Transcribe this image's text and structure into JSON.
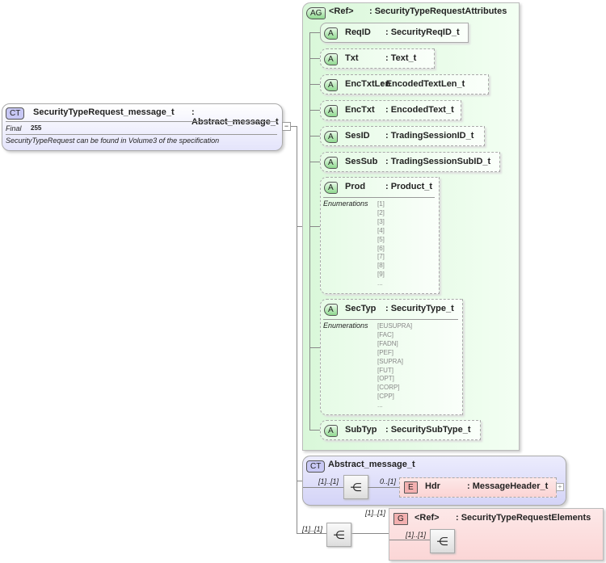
{
  "main_type": {
    "badge": "CT",
    "name": "SecurityTypeRequest_message_t",
    "base": ": Abstract_message_t",
    "final_label": "Final",
    "final_value": "255",
    "doc": "SecurityTypeRequest can be found in Volume3 of the specification"
  },
  "attribute_group": {
    "badge": "AG",
    "name": "<Ref>",
    "type": ": SecurityTypeRequestAttributes"
  },
  "attributes": [
    {
      "badge": "A",
      "name": "ReqID",
      "type": ": SecurityReqID_t"
    },
    {
      "badge": "A",
      "name": "Txt",
      "type": ": Text_t"
    },
    {
      "badge": "A",
      "name": "EncTxtLen",
      "type": ": EncodedTextLen_t"
    },
    {
      "badge": "A",
      "name": "EncTxt",
      "type": ": EncodedText_t"
    },
    {
      "badge": "A",
      "name": "SesID",
      "type": ": TradingSessionID_t"
    },
    {
      "badge": "A",
      "name": "SesSub",
      "type": ": TradingSessionSubID_t"
    },
    {
      "badge": "A",
      "name": "Prod",
      "type": ": Product_t",
      "enum_label": "Enumerations",
      "enums": "[1]\n[2]\n[3]\n[4]\n[5]\n[6]\n[7]\n[8]\n[9]\n..."
    },
    {
      "badge": "A",
      "name": "SecTyp",
      "type": ": SecurityType_t",
      "enum_label": "Enumerations",
      "enums": "[EUSUPRA]\n[FAC]\n[FADN]\n[PEF]\n[SUPRA]\n[FUT]\n[OPT]\n[CORP]\n[CPP]\n..."
    },
    {
      "badge": "A",
      "name": "SubTyp",
      "type": ": SecuritySubType_t"
    }
  ],
  "abstract": {
    "badge": "CT",
    "name": "Abstract_message_t",
    "seq_card": "[1]..[1]",
    "elem_card": "0..[1]",
    "elem_badge": "E",
    "elem_name": "Hdr",
    "elem_type": ": MessageHeader_t"
  },
  "sequence": {
    "card": "[1]..[1]"
  },
  "group": {
    "card": "[1]..[1]",
    "badge": "G",
    "name": "<Ref>",
    "type": ": SecurityTypeRequestElements",
    "inner_card": "[1]..[1]"
  }
}
